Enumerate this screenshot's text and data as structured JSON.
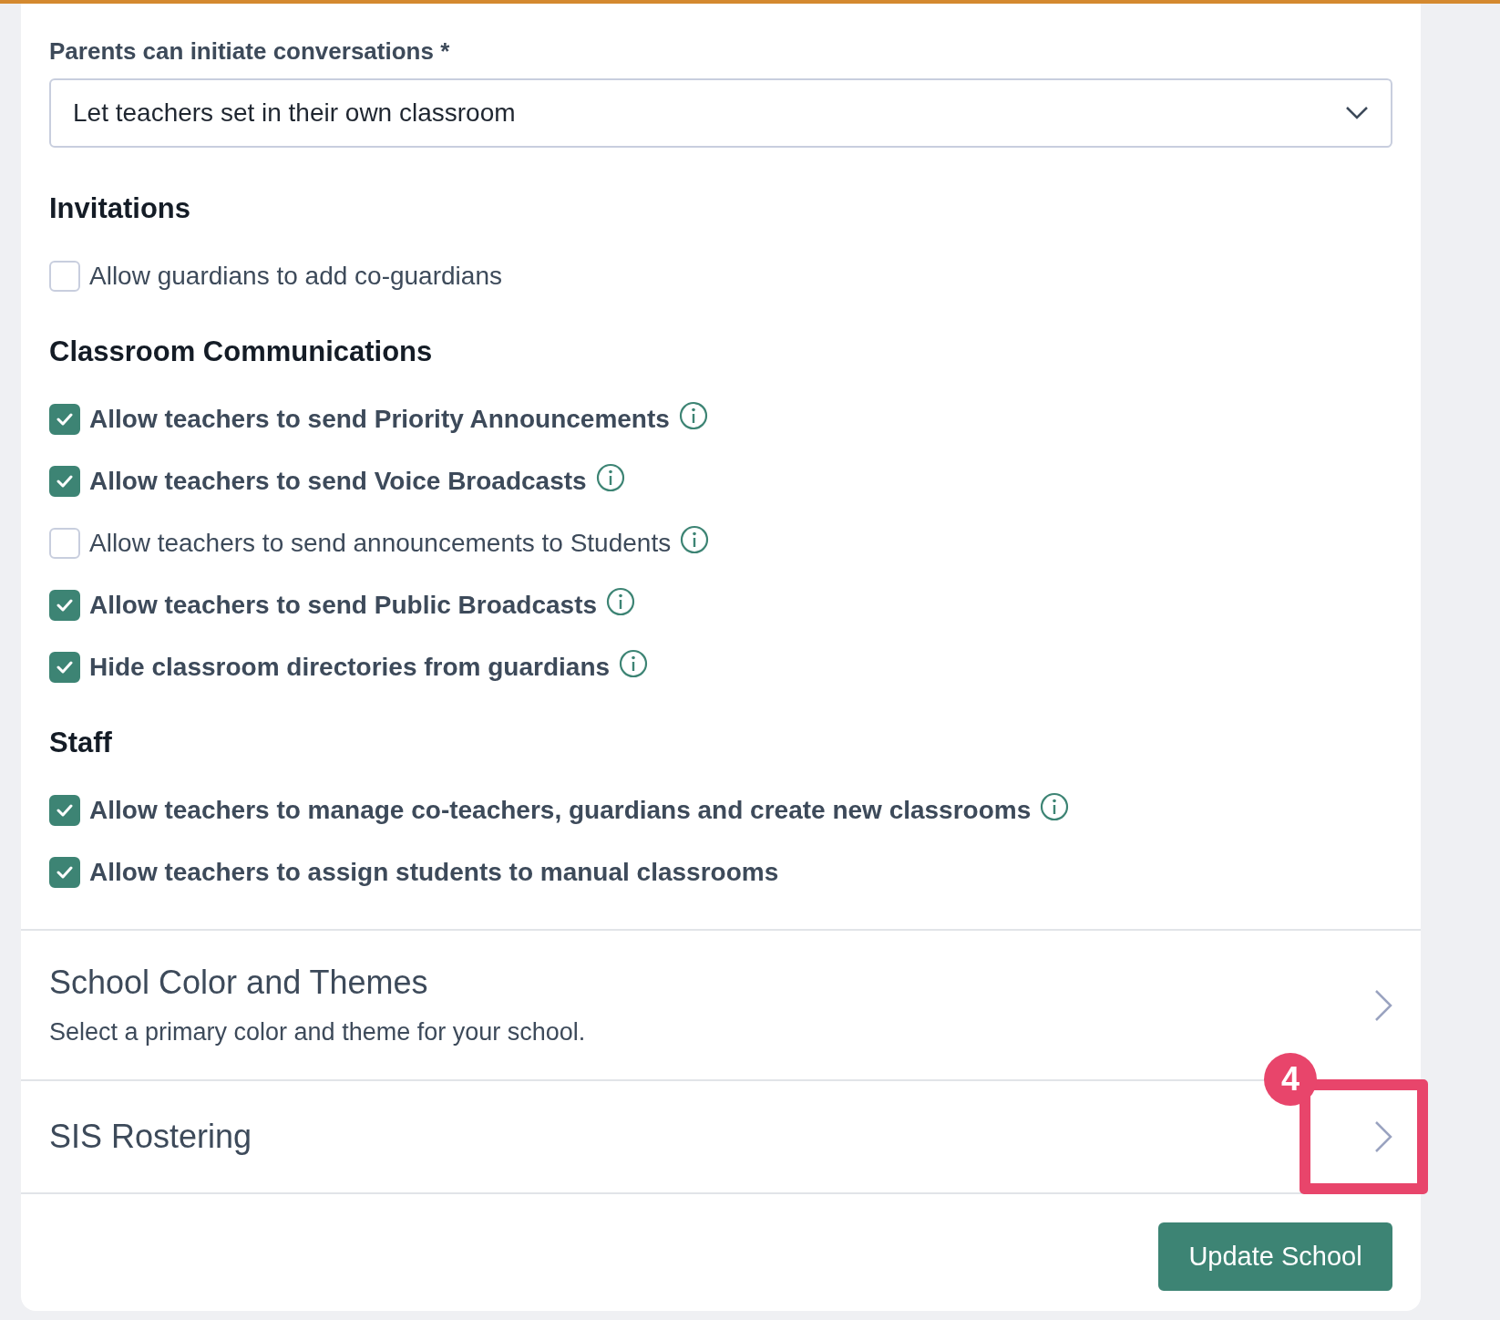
{
  "field": {
    "label": "Parents can initiate conversations *",
    "value": "Let teachers set in their own classroom"
  },
  "sections": [
    {
      "heading": "Invitations",
      "options": [
        {
          "label": "Allow guardians to add co-guardians",
          "checked": false,
          "info": false
        }
      ]
    },
    {
      "heading": "Classroom Communications",
      "options": [
        {
          "label": "Allow teachers to send Priority Announcements",
          "checked": true,
          "info": true
        },
        {
          "label": "Allow teachers to send Voice Broadcasts",
          "checked": true,
          "info": true
        },
        {
          "label": "Allow teachers to send announcements to Students",
          "checked": false,
          "info": true
        },
        {
          "label": "Allow teachers to send Public Broadcasts",
          "checked": true,
          "info": true
        },
        {
          "label": "Hide classroom directories from guardians",
          "checked": true,
          "info": true
        }
      ]
    },
    {
      "heading": "Staff",
      "options": [
        {
          "label": "Allow teachers to manage co-teachers, guardians and create new classrooms",
          "checked": true,
          "info": true
        },
        {
          "label": "Allow teachers to assign students to manual classrooms",
          "checked": true,
          "info": false
        }
      ]
    }
  ],
  "links": [
    {
      "title": "School Color and Themes",
      "subtitle": "Select a primary color and theme for your school."
    },
    {
      "title": "SIS Rostering",
      "annotation": "4"
    }
  ],
  "button": "Update School"
}
